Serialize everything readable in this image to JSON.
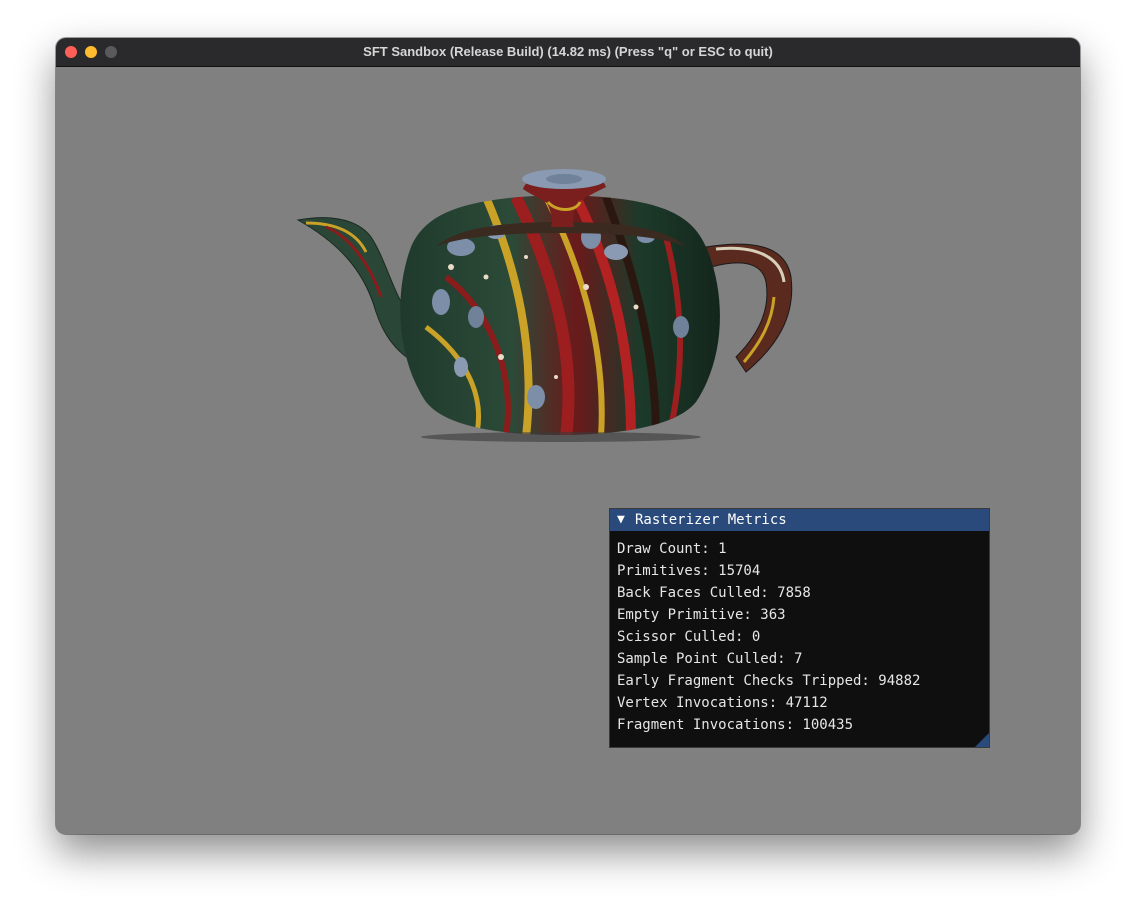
{
  "window": {
    "title": "SFT Sandbox (Release Build) (14.82 ms) (Press \"q\" or ESC to quit)"
  },
  "icons": {
    "close": "close-icon",
    "minimize": "minimize-icon",
    "zoom": "zoom-icon",
    "collapse": "triangle-down-icon",
    "resize": "resize-grip-icon"
  },
  "colors": {
    "viewport_bg": "#808080",
    "titlebar_bg": "#2a2a2c",
    "panel_header": "#294a7a",
    "panel_bg": "#0f0f10"
  },
  "metrics_panel": {
    "collapse_glyph": "▼",
    "title": "Rasterizer Metrics",
    "lines": [
      "Draw Count: 1",
      "Primitives: 15704",
      "Back Faces Culled: 7858",
      "Empty Primitive: 363",
      "Scissor Culled: 0",
      "Sample Point Culled: 7",
      "Early Fragment Checks Tripped: 94882",
      "Vertex Invocations: 47112",
      "Fragment Invocations: 100435"
    ]
  }
}
